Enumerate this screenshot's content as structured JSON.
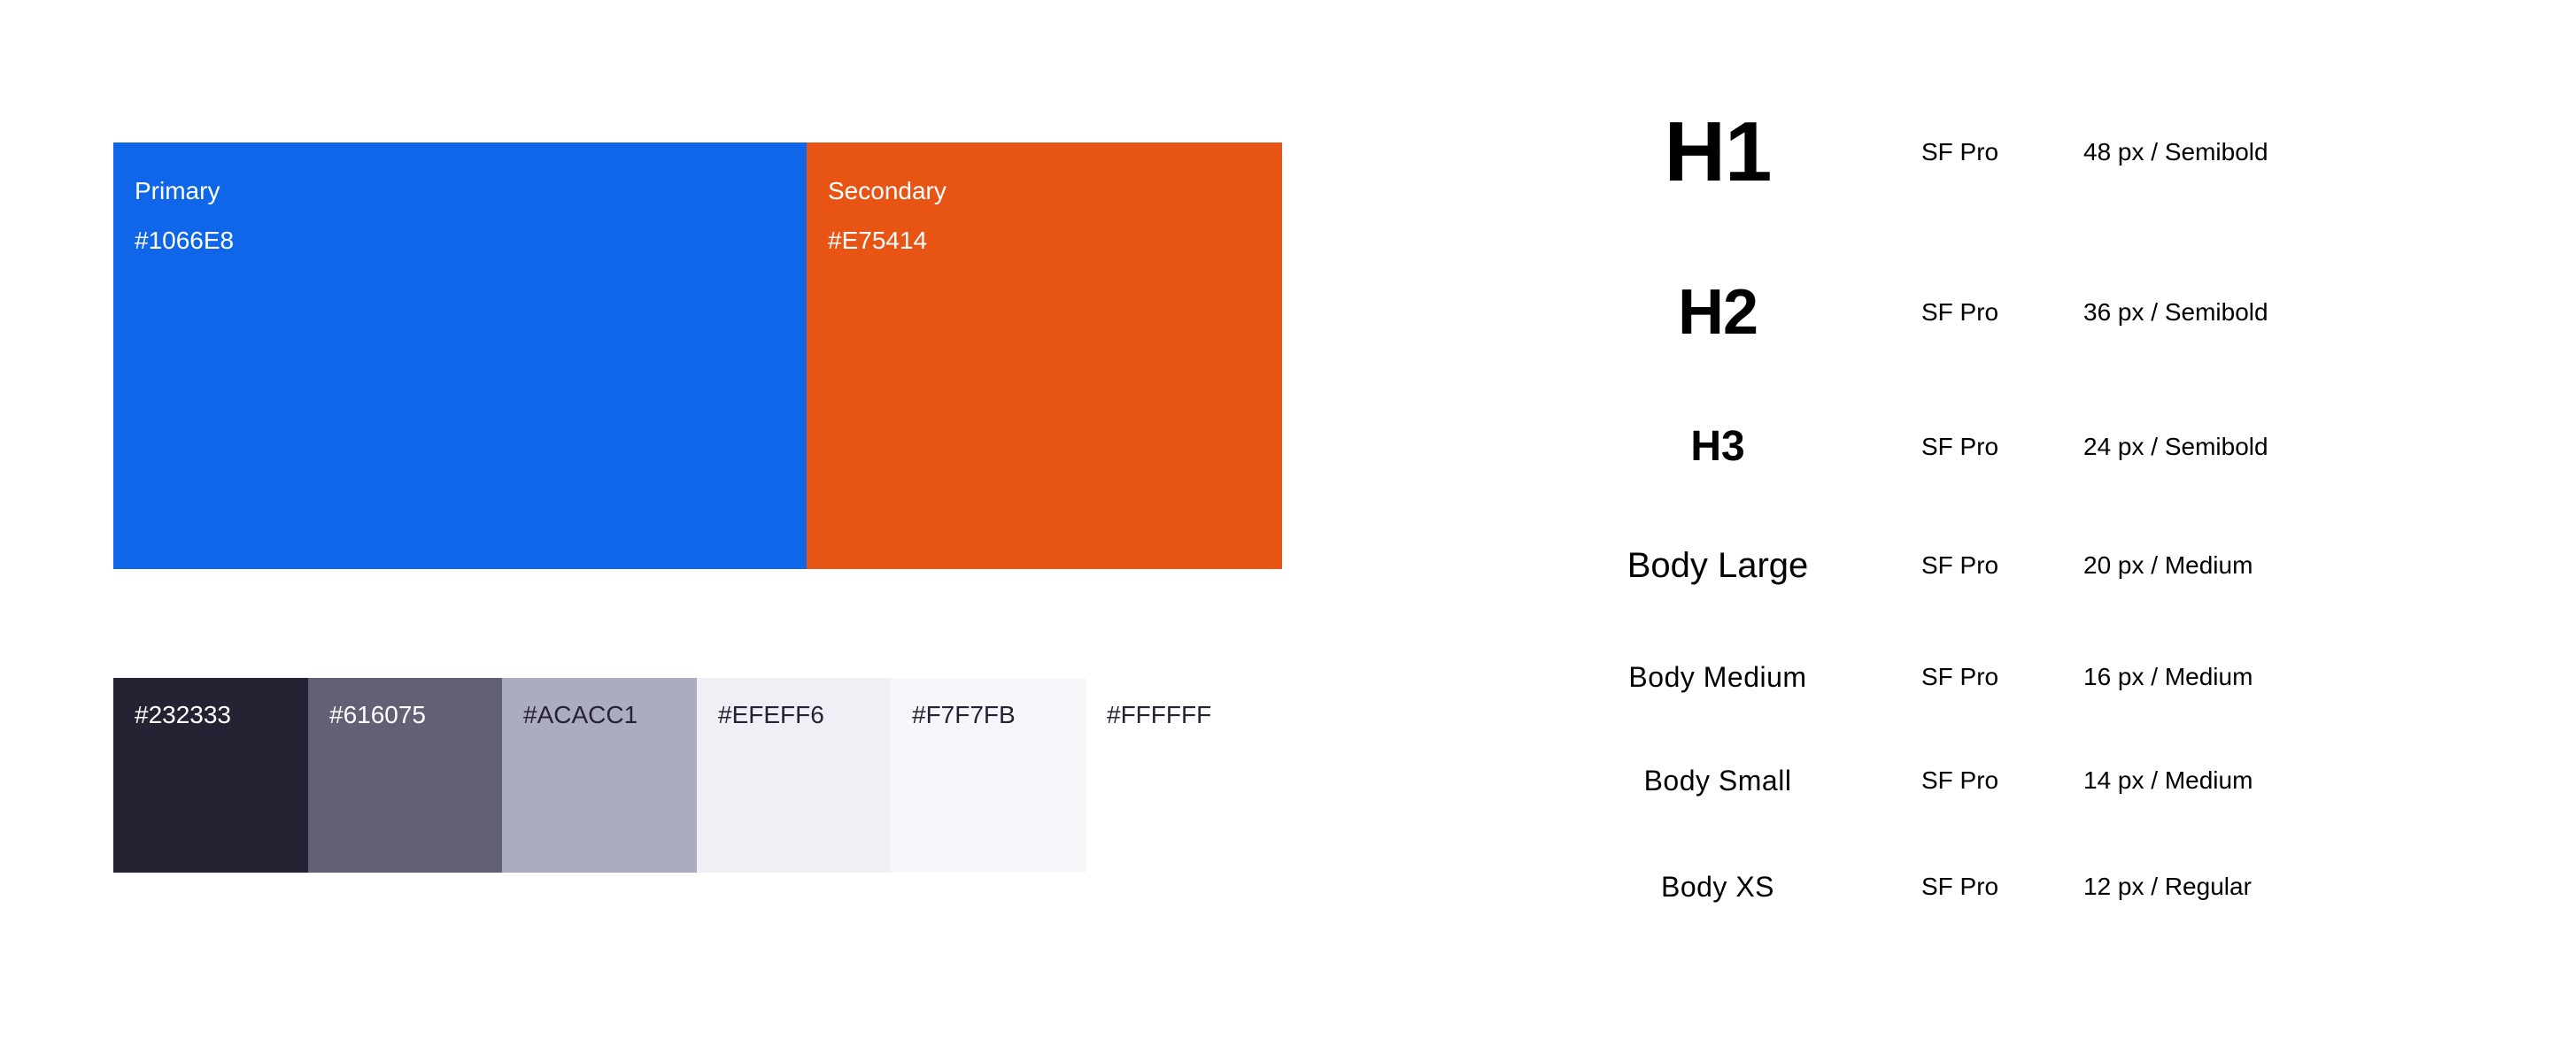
{
  "palette": {
    "primary": {
      "name": "Primary",
      "hex": "#1066E8",
      "color": "#1066E8",
      "text_color": "#FFFFFF"
    },
    "secondary": {
      "name": "Secondary",
      "hex": "#E75414",
      "color": "#E75414",
      "text_color": "#FFFFFF"
    },
    "neutrals": [
      {
        "hex": "#232333",
        "color": "#232333",
        "text_color": "#FFFFFF"
      },
      {
        "hex": "#616075",
        "color": "#616075",
        "text_color": "#FFFFFF"
      },
      {
        "hex": "#ACACC1",
        "color": "#ACACC1",
        "text_color": "#232333"
      },
      {
        "hex": "#EFEFF6",
        "color": "#EFEFF6",
        "text_color": "#232333"
      },
      {
        "hex": "#F7F7FB",
        "color": "#F7F7FB",
        "text_color": "#232333"
      },
      {
        "hex": "#FFFFFF",
        "color": "#FFFFFF",
        "text_color": "#232333"
      }
    ]
  },
  "typography": [
    {
      "sample": "H1",
      "font": "SF Pro",
      "spec": "48 px / Semibold"
    },
    {
      "sample": "H2",
      "font": "SF Pro",
      "spec": "36 px / Semibold"
    },
    {
      "sample": "H3",
      "font": "SF Pro",
      "spec": "24 px / Semibold"
    },
    {
      "sample": "Body Large",
      "font": "SF Pro",
      "spec": "20 px / Medium"
    },
    {
      "sample": "Body Medium",
      "font": "SF Pro",
      "spec": "16 px / Medium"
    },
    {
      "sample": "Body Small",
      "font": "SF Pro",
      "spec": "14 px / Medium"
    },
    {
      "sample": "Body XS",
      "font": "SF Pro",
      "spec": "12 px / Regular"
    }
  ]
}
